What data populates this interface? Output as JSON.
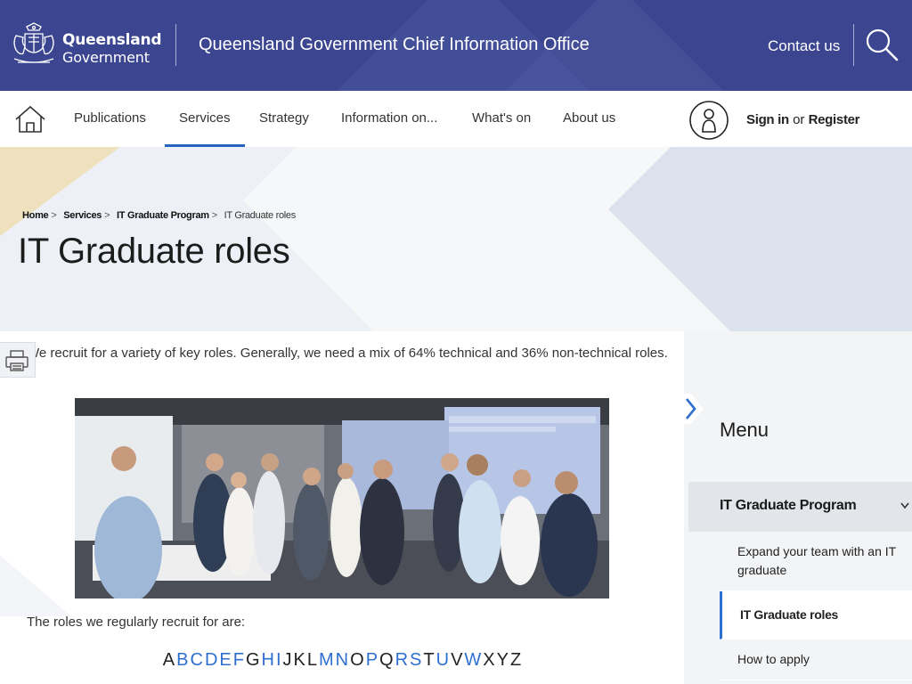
{
  "header": {
    "logo_line1": "Queensland",
    "logo_line2": "Government",
    "site_title": "Queensland Government Chief Information Office",
    "contact_label": "Contact us",
    "search_icon": "search-icon",
    "bg_color": "#3b4590"
  },
  "nav": {
    "home_icon": "home-icon",
    "items": [
      {
        "label": "Publications"
      },
      {
        "label": "Services",
        "active": true
      },
      {
        "label": "Strategy"
      },
      {
        "label": "Information on..."
      },
      {
        "label": "What's on"
      },
      {
        "label": "About us"
      }
    ],
    "user_icon": "user-icon",
    "signin_label": "Sign in",
    "or_label": "or",
    "register_label": "Register",
    "accent_color": "#2463c0"
  },
  "breadcrumb": {
    "items": [
      "Home",
      "Services",
      "IT Graduate Program"
    ],
    "sep": ">",
    "current": "IT Graduate roles"
  },
  "page": {
    "title": "IT Graduate roles",
    "intro": "We recruit for a variety of key roles. Generally, we need a mix of 64% technical and 36% non-technical roles.",
    "roles_lead": "The roles we regularly recruit for are:",
    "print_icon": "printer-icon",
    "alphabet": [
      {
        "l": "A",
        "link": false
      },
      {
        "l": "B",
        "link": true
      },
      {
        "l": "C",
        "link": true
      },
      {
        "l": "D",
        "link": true
      },
      {
        "l": "E",
        "link": true
      },
      {
        "l": "F",
        "link": true
      },
      {
        "l": "G",
        "link": false
      },
      {
        "l": "H",
        "link": true
      },
      {
        "l": "I",
        "link": true
      },
      {
        "l": "J",
        "link": false
      },
      {
        "l": "K",
        "link": false
      },
      {
        "l": "L",
        "link": false
      },
      {
        "l": "M",
        "link": true
      },
      {
        "l": "N",
        "link": true
      },
      {
        "l": "O",
        "link": false
      },
      {
        "l": "P",
        "link": true
      },
      {
        "l": "Q",
        "link": false
      },
      {
        "l": "R",
        "link": true
      },
      {
        "l": "S",
        "link": true
      },
      {
        "l": "T",
        "link": false
      },
      {
        "l": "U",
        "link": true
      },
      {
        "l": "V",
        "link": false
      },
      {
        "l": "W",
        "link": true
      },
      {
        "l": "X",
        "link": false
      },
      {
        "l": "Y",
        "link": false
      },
      {
        "l": "Z",
        "link": false
      }
    ],
    "link_color": "#2e6fd0"
  },
  "sidebar": {
    "menu_title": "Menu",
    "parent": "IT Graduate Program",
    "children": [
      {
        "label": "Expand your team with an IT graduate",
        "active": false
      },
      {
        "label": "IT Graduate roles",
        "active": true
      },
      {
        "label": "How to apply",
        "active": false
      }
    ]
  }
}
